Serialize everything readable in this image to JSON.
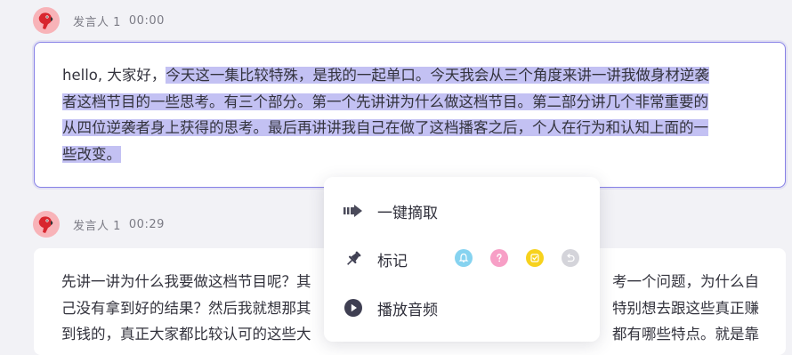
{
  "segments": [
    {
      "speaker": "发言人 1",
      "time": "00:00",
      "text_plain": "hello, 大家好，",
      "text_selected_1": "今天这一集比较特殊，是我的一起单口。今天我会从三个角度来讲一讲我做身材逆袭",
      "text_selected_2": "者这档节目的一些思考。有三个部分。第一个先讲讲为什么做这档节目。第二部分讲几个非常重要的",
      "text_selected_3": "从四位逆袭者身上获得的思考。最后再讲讲我自己在做了这档播客之后，个人在行为和认知上面的一",
      "text_selected_4": "些改变。"
    },
    {
      "speaker": "发言人 1",
      "time": "00:29",
      "line_1a": "先讲一讲为什么我要做这档节目呢？其",
      "line_1b": "考一个问题，为什么自",
      "line_2a": "己没有拿到好的结果？然后我就想那其",
      "line_2b": "特别想去跟这些真正赚",
      "line_3a": "到钱的，真正大家都比较认可的这些大",
      "line_3b": "都有哪些特点。就是靠"
    }
  ],
  "context_menu": {
    "extract_label": "一键摘取",
    "mark_label": "标记",
    "play_label": "播放音频",
    "tag_colors": [
      "#86d3f0",
      "#f79fc6",
      "#f7d21d",
      "#d4d4da"
    ]
  },
  "colors": {
    "accent": "#8781e6",
    "selection": "#c3c1f3",
    "avatar_bg": "#f8b3b8"
  }
}
